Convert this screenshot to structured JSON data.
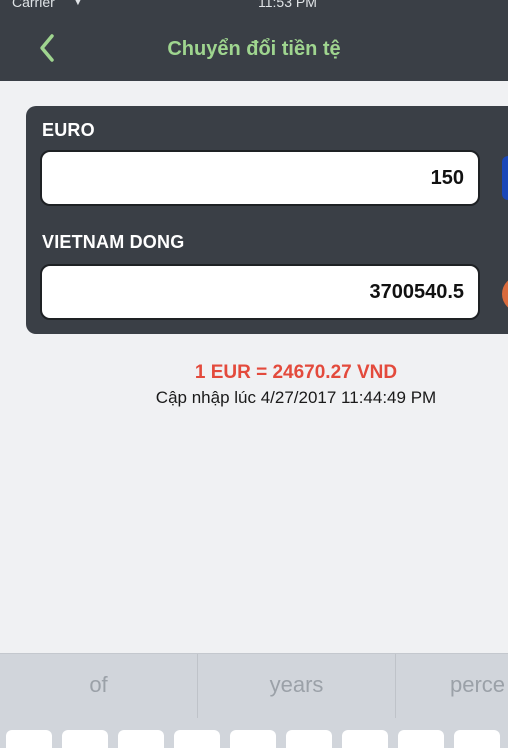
{
  "status_bar": {
    "carrier": "Carrier",
    "time": "11:53 PM"
  },
  "nav": {
    "title": "Chuyển đổi tiền tệ"
  },
  "converter": {
    "from_label": "EURO",
    "from_value": "150",
    "to_label": "VIETNAM DONG",
    "to_value": "3700540.5"
  },
  "rate": {
    "text": "1 EUR = 24670.27 VND",
    "updated": "Cập nhập lúc 4/27/2017 11:44:49 PM"
  },
  "keyboard": {
    "suggestions": [
      "of",
      "years",
      "perce"
    ]
  },
  "colors": {
    "header_bg": "#3a3f46",
    "title_green": "#9fd58f",
    "rate_red": "#e34a3c",
    "background": "#f0f1f3"
  }
}
